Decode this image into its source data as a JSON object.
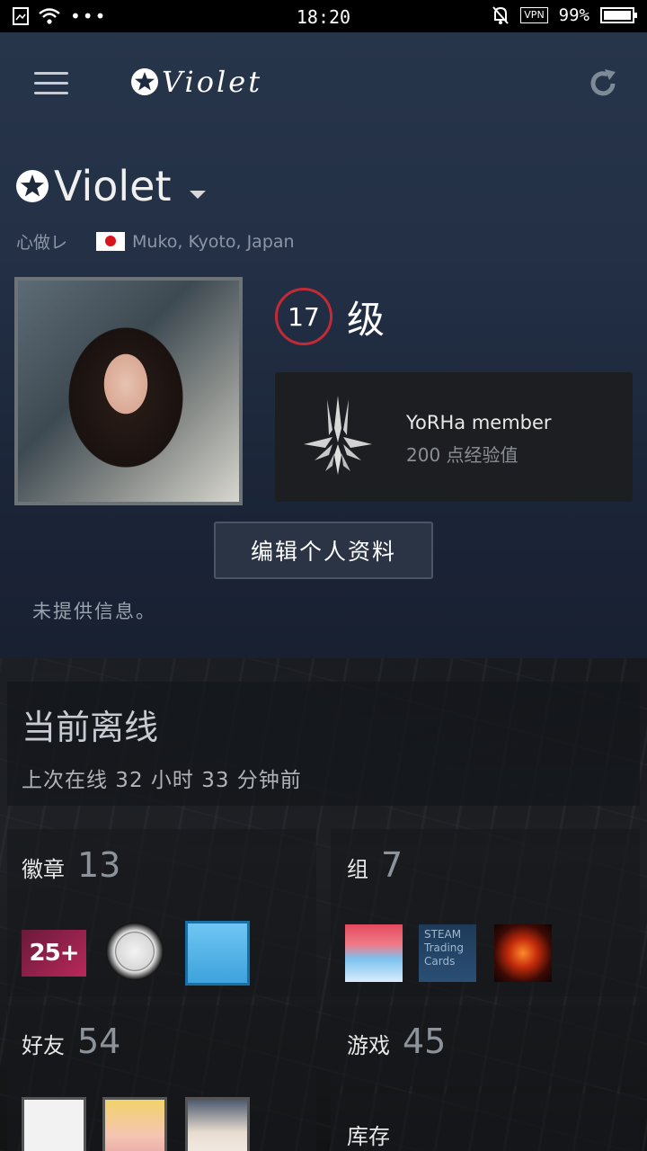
{
  "status_bar": {
    "time": "18:20",
    "vpn": "VPN",
    "battery": "99%"
  },
  "appbar": {
    "title": "Violet"
  },
  "profile": {
    "persona_name": "Violet",
    "real_name": "心做レ",
    "location": "Muko, Kyoto, Japan",
    "level": "17",
    "level_suffix": "级",
    "badge_name": "YoRHa member",
    "badge_xp": "200 点经验值",
    "edit_button": "编辑个人资料",
    "summary": "未提供信息。"
  },
  "status": {
    "title": "当前离线",
    "last_online": "上次在线 32 小时 33 分钟前"
  },
  "sections": {
    "badges": {
      "label": "徽章",
      "count": "13",
      "first_badge": "25+"
    },
    "groups": {
      "label": "组",
      "count": "7",
      "steam_cards": "STEAM Trading Cards"
    },
    "friends": {
      "label": "好友",
      "count": "54"
    },
    "games": {
      "label": "游戏",
      "count": "45"
    },
    "inventory": {
      "label": "库存"
    }
  },
  "colors": {
    "header_bg": "#233046",
    "level_ring": "#c22a36",
    "card_bg": "#1d1e22"
  }
}
